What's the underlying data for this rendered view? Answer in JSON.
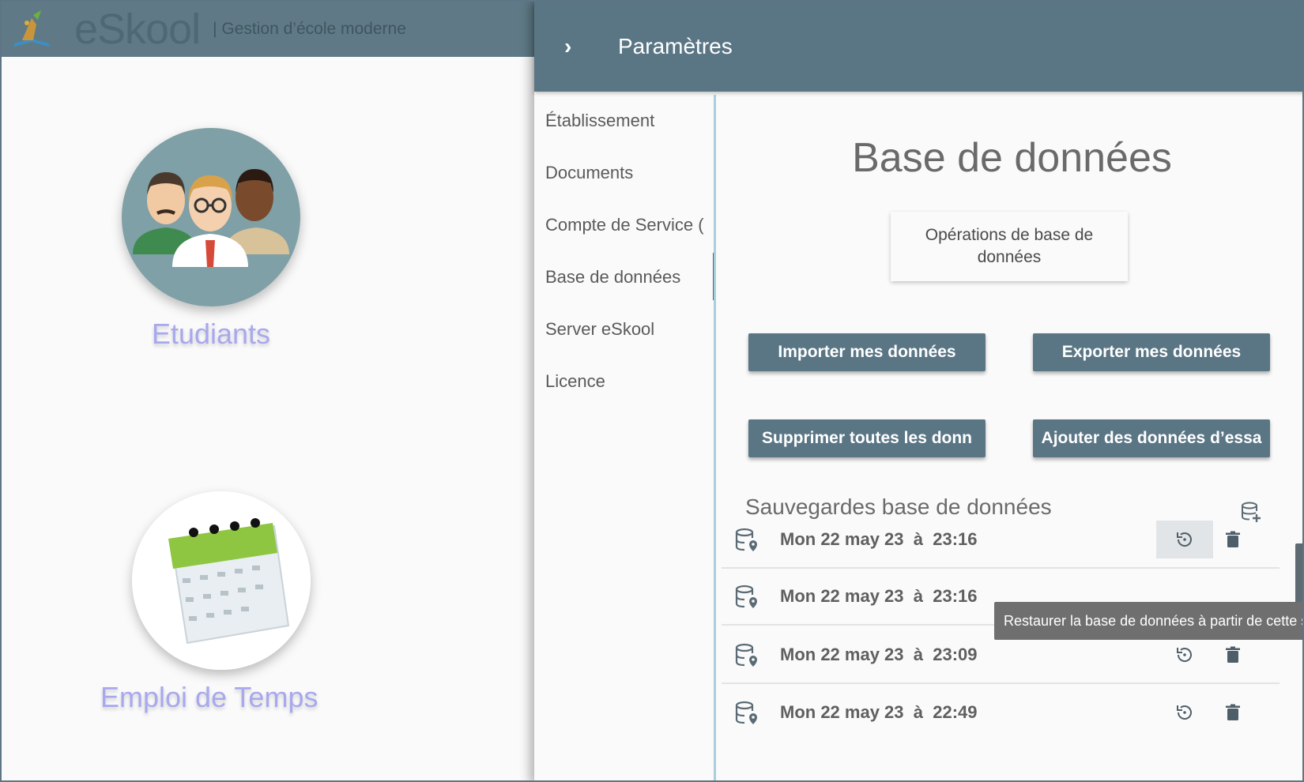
{
  "app": {
    "brand": "eSkool",
    "tagline": "Gestion d’école moderne"
  },
  "home": {
    "tiles": [
      {
        "label": "Etudiants",
        "icon": "students-icon"
      },
      {
        "label": "Emploi de Temps",
        "icon": "calendar-icon"
      }
    ]
  },
  "settings": {
    "title": "Paramètres",
    "nav": [
      {
        "label": "Établissement"
      },
      {
        "label": "Documents"
      },
      {
        "label": "Compte de Service ("
      },
      {
        "label": "Base de données",
        "active": true
      },
      {
        "label": "Server eSkool"
      },
      {
        "label": "Licence"
      }
    ],
    "page_title": "Base de données",
    "ops_card": "Opérations de base de données",
    "buttons": {
      "import": "Importer mes données",
      "export": "Exporter mes données",
      "delete_all": "Supprimer toutes les donn",
      "sample": "Ajouter des données d’essa"
    },
    "backups_title": "Sauvegardes base de données",
    "backups": [
      {
        "date": "Mon 22 may 23",
        "at": "à",
        "time": "23:16"
      },
      {
        "date": "Mon 22 may 23",
        "at": "à",
        "time": "23:16"
      },
      {
        "date": "Mon 22 may 23",
        "at": "à",
        "time": "23:09"
      },
      {
        "date": "Mon 22 may 23",
        "at": "à",
        "time": "22:49"
      }
    ],
    "tooltip": "Restaurer la base de données à partir de cette sa"
  },
  "colors": {
    "header": "#5a7685",
    "button": "#5a7685",
    "tile_label": "#a8a8ee",
    "nav_divider": "#a9cfdc"
  }
}
